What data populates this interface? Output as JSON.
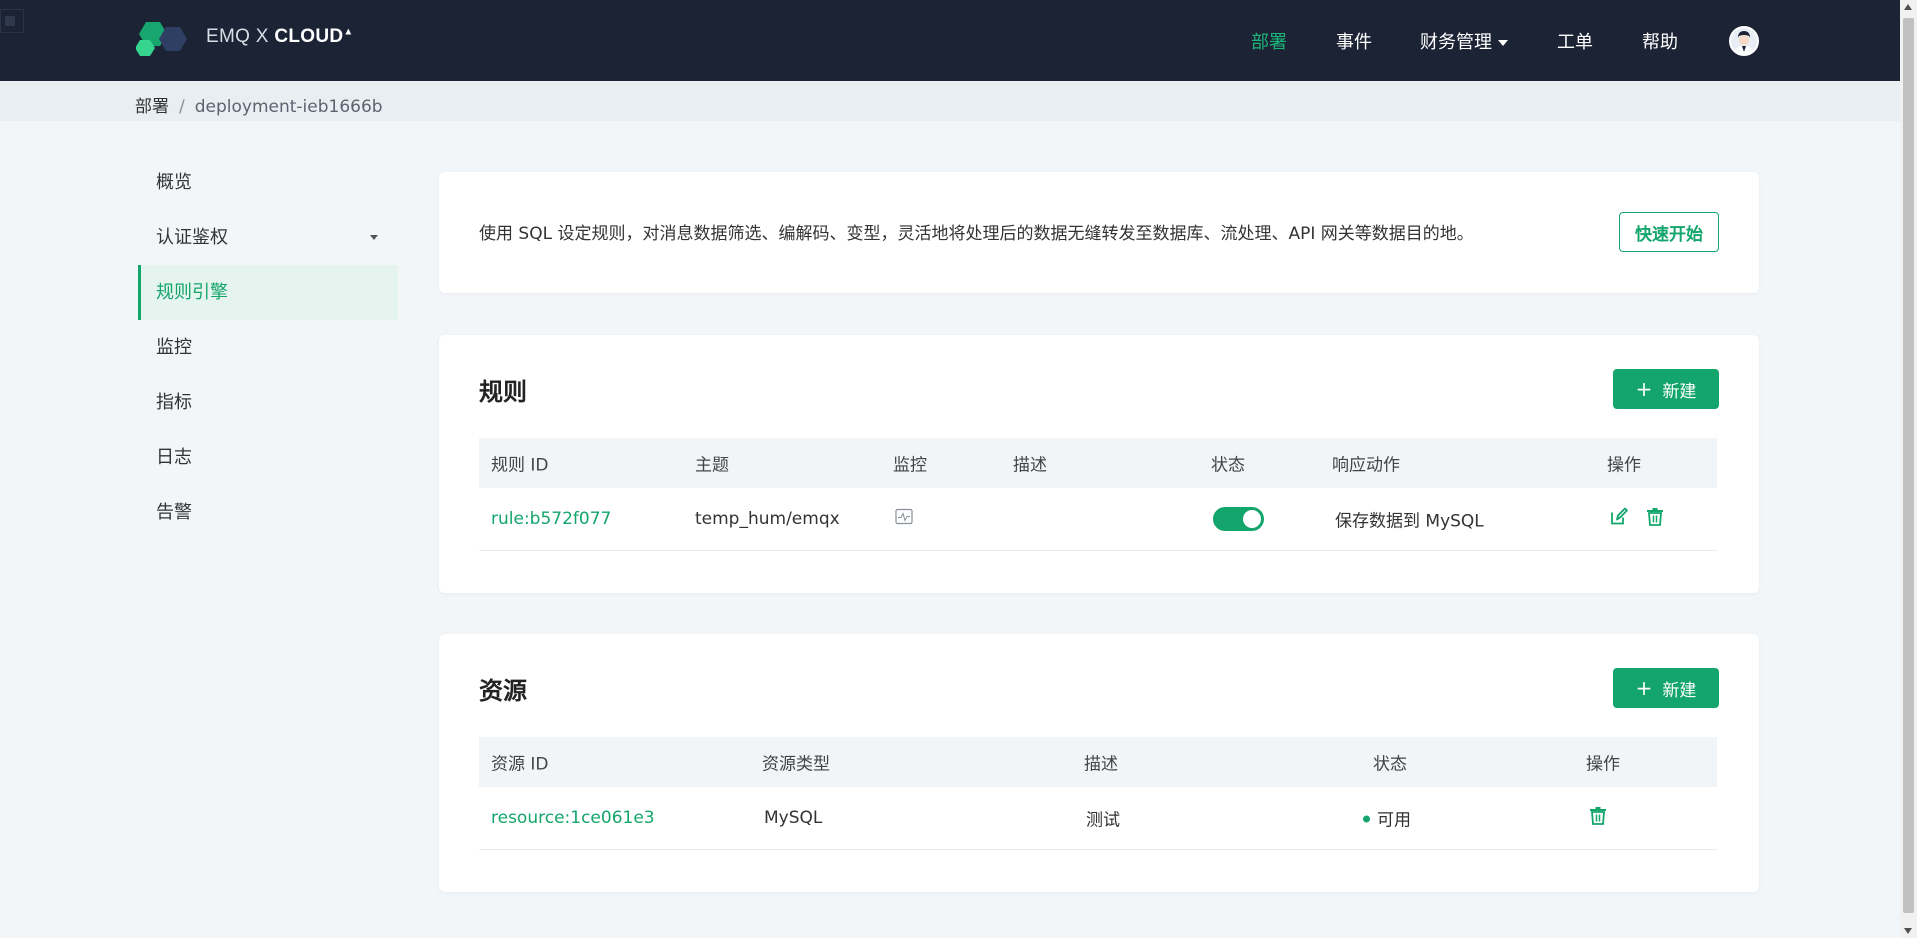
{
  "navbar": {
    "logo_text_light": "EMQ X ",
    "logo_text_bold": "CLOUD",
    "menu": {
      "deploy": "部署",
      "events": "事件",
      "finance": "财务管理",
      "tickets": "工单",
      "help": "帮助"
    },
    "active_color": "#1bb57a",
    "background": "#1b2334"
  },
  "breadcrumb": {
    "root": "部署",
    "separator": "/",
    "current": "deployment-ieb1666b"
  },
  "sidebar": {
    "items": [
      {
        "label": "概览"
      },
      {
        "label": "认证鉴权"
      },
      {
        "label": "规则引擎"
      },
      {
        "label": "监控"
      },
      {
        "label": "指标"
      },
      {
        "label": "日志"
      },
      {
        "label": "告警"
      }
    ]
  },
  "intro": {
    "text": "使用 SQL 设定规则，对消息数据筛选、编解码、变型，灵活地将处理后的数据无缝转发至数据库、流处理、API 网关等数据目的地。",
    "quick_start": "快速开始"
  },
  "rules": {
    "title": "规则",
    "new_button": "新建",
    "headers": {
      "id": "规则 ID",
      "topic": "主题",
      "monitor": "监控",
      "desc": "描述",
      "status": "状态",
      "action": "响应动作",
      "ops": "操作"
    },
    "rows": [
      {
        "id": "rule:b572f077",
        "topic": "temp_hum/emqx",
        "desc": "",
        "enabled": true,
        "action": "保存数据到 MySQL"
      }
    ]
  },
  "resources": {
    "title": "资源",
    "new_button": "新建",
    "headers": {
      "id": "资源 ID",
      "type": "资源类型",
      "desc": "描述",
      "status": "状态",
      "ops": "操作"
    },
    "rows": [
      {
        "id": "resource:1ce061e3",
        "type": "MySQL",
        "desc": "测试",
        "status": "可用"
      }
    ]
  },
  "brand_color": "#13a56c"
}
